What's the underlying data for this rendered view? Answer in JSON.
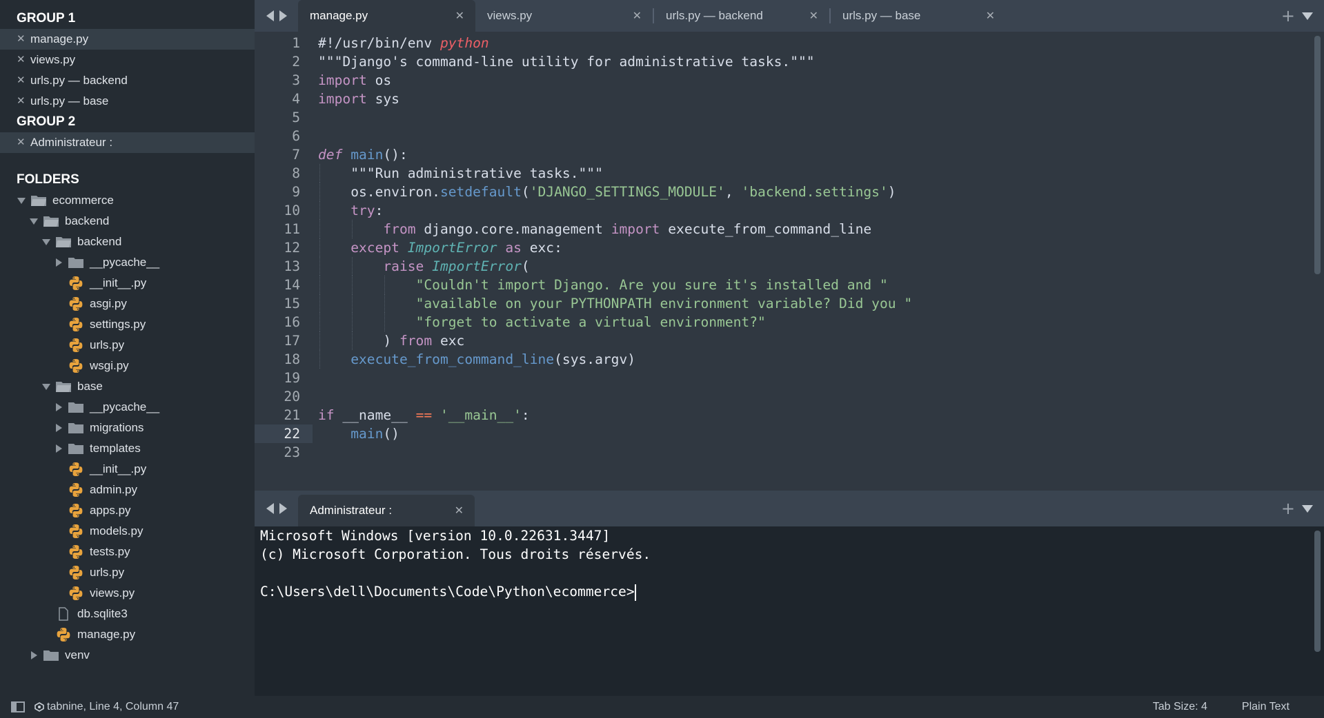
{
  "sidebar": {
    "group1_label": "GROUP 1",
    "group1_files": [
      "manage.py",
      "views.py",
      "urls.py — backend",
      "urls.py — base"
    ],
    "group2_label": "GROUP 2",
    "group2_files": [
      "Administrateur :"
    ],
    "folders_label": "FOLDERS",
    "tree": [
      {
        "name": "ecommerce",
        "kind": "folder-open"
      },
      {
        "name": "backend",
        "kind": "folder-open"
      },
      {
        "name": "backend",
        "kind": "folder-open"
      },
      {
        "name": "__pycache__",
        "kind": "folder-closed"
      },
      {
        "name": "__init__.py",
        "kind": "python"
      },
      {
        "name": "asgi.py",
        "kind": "python"
      },
      {
        "name": "settings.py",
        "kind": "python"
      },
      {
        "name": "urls.py",
        "kind": "python"
      },
      {
        "name": "wsgi.py",
        "kind": "python"
      },
      {
        "name": "base",
        "kind": "folder-open"
      },
      {
        "name": "__pycache__",
        "kind": "folder-closed"
      },
      {
        "name": "migrations",
        "kind": "folder-closed"
      },
      {
        "name": "templates",
        "kind": "folder-closed"
      },
      {
        "name": "__init__.py",
        "kind": "python"
      },
      {
        "name": "admin.py",
        "kind": "python"
      },
      {
        "name": "apps.py",
        "kind": "python"
      },
      {
        "name": "models.py",
        "kind": "python"
      },
      {
        "name": "tests.py",
        "kind": "python"
      },
      {
        "name": "urls.py",
        "kind": "python"
      },
      {
        "name": "views.py",
        "kind": "python"
      },
      {
        "name": "db.sqlite3",
        "kind": "file"
      },
      {
        "name": "manage.py",
        "kind": "python"
      },
      {
        "name": "venv",
        "kind": "folder-closed"
      }
    ]
  },
  "editor_tabs": [
    "manage.py",
    "views.py",
    "urls.py — backend",
    "urls.py — base"
  ],
  "active_editor_tab": "manage.py",
  "code_lines": [
    "1",
    "2",
    "3",
    "4",
    "5",
    "6",
    "7",
    "8",
    "9",
    "10",
    "11",
    "12",
    "13",
    "14",
    "15",
    "16",
    "17",
    "18",
    "19",
    "20",
    "21",
    "22",
    "23"
  ],
  "code": {
    "l1a": "#!/usr/bin/env ",
    "l1b": "python",
    "l2": "\"\"\"Django's command-line utility for administrative tasks.\"\"\"",
    "l3a": "import",
    "l3b": " os",
    "l4a": "import",
    "l4b": " sys",
    "l7a": "def",
    "l7b": "main",
    "l7c": "():",
    "l8": "\"\"\"Run administrative tasks.\"\"\"",
    "l9a": "os.environ.",
    "l9b": "setdefault",
    "l9c": "(",
    "l9d": "'DJANGO_SETTINGS_MODULE'",
    "l9e": ", ",
    "l9f": "'backend.settings'",
    "l9g": ")",
    "l10a": "try",
    "l10b": ":",
    "l11a": "from",
    "l11b": " django.core.management ",
    "l11c": "import",
    "l11d": " execute_from_command_line",
    "l12a": "except",
    "l12b": "ImportError",
    "l12c": "as",
    "l12d": " exc:",
    "l13a": "raise",
    "l13b": "ImportError",
    "l13c": "(",
    "l14": "\"Couldn't import Django. Are you sure it's installed and \"",
    "l15": "\"available on your PYTHONPATH environment variable? Did you \"",
    "l16": "\"forget to activate a virtual environment?\"",
    "l17a": ") ",
    "l17b": "from",
    "l17c": " exc",
    "l18a": "execute_from_command_line",
    "l18b": "(sys.argv)",
    "l21a": "if",
    "l21b": " __name__ ",
    "l21c": "==",
    "l21d": "'__main__'",
    "l21e": ":",
    "l22a": "main",
    "l22b": "()"
  },
  "current_line": "22",
  "terminal_tab": "Administrateur :",
  "terminal": {
    "line1": "Microsoft Windows [version 10.0.22631.3447]",
    "line2": "(c) Microsoft Corporation. Tous droits réservés.",
    "line3": "",
    "line4": "C:\\Users\\dell\\Documents\\Code\\Python\\ecommerce>"
  },
  "status": {
    "left": "tabnine, Line 4, Column 47",
    "tab_size": "Tab Size: 4",
    "syntax": "Plain Text"
  },
  "colors": {
    "background": "#303841",
    "sidebar": "#252c33",
    "keyword": "#c594c5",
    "string": "#99c794",
    "function": "#6699cc",
    "class": "#5fb3b3",
    "python_icon": "#e8a33d"
  }
}
